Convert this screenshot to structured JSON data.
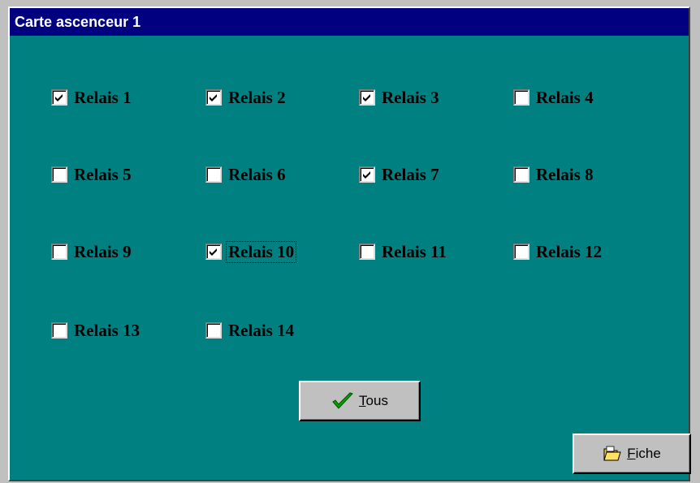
{
  "window": {
    "title": "Carte ascenceur 1"
  },
  "relays": [
    {
      "label": "Relais 1",
      "checked": true
    },
    {
      "label": "Relais 2",
      "checked": true
    },
    {
      "label": "Relais 3",
      "checked": true
    },
    {
      "label": "Relais 4",
      "checked": false
    },
    {
      "label": "Relais 5",
      "checked": false
    },
    {
      "label": "Relais 6",
      "checked": false
    },
    {
      "label": "Relais 7",
      "checked": true
    },
    {
      "label": "Relais 8",
      "checked": false
    },
    {
      "label": "Relais 9",
      "checked": false
    },
    {
      "label": "Relais 10",
      "checked": true,
      "focused": true
    },
    {
      "label": "Relais 11",
      "checked": false
    },
    {
      "label": "Relais 12",
      "checked": false
    },
    {
      "label": "Relais 13",
      "checked": false
    },
    {
      "label": "Relais 14",
      "checked": false
    }
  ],
  "buttons": {
    "tous": {
      "accel": "T",
      "rest": "ous",
      "icon": "green-checkmark-icon"
    },
    "fiche": {
      "accel": "F",
      "rest": "iche",
      "icon": "folder-icon"
    }
  },
  "colors": {
    "background": "#008080",
    "titlebar": "#000080",
    "button_face": "#c0c0c0"
  }
}
